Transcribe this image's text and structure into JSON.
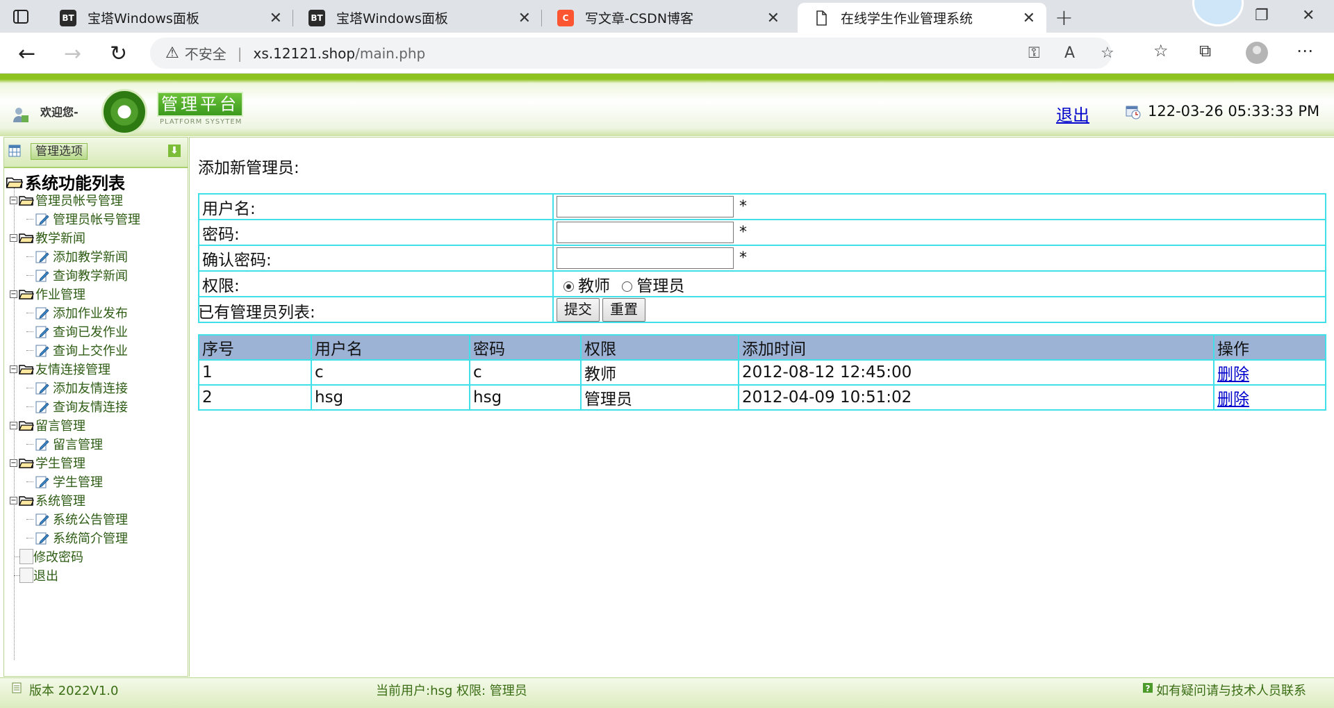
{
  "browser": {
    "tabs": [
      {
        "favicon_text": "BT",
        "favicon_color": "#2b2b2b",
        "title": "宝塔Windows面板"
      },
      {
        "favicon_text": "BT",
        "favicon_color": "#2b2b2b",
        "title": "宝塔Windows面板"
      },
      {
        "favicon_text": "C",
        "favicon_color": "#fc5531",
        "title": "写文章-CSDN博客"
      },
      {
        "favicon_text": "",
        "favicon_color": "#ffffff",
        "title": "在线学生作业管理系统"
      }
    ],
    "active_tab": 3,
    "address": {
      "security_label": "不安全",
      "host": "xs.12121.shop",
      "path": "/main.php"
    }
  },
  "header": {
    "greeting": "欢迎您-",
    "title": "管理平台",
    "subtitle": "PLATFORM SYSYTEM",
    "logout": "退出",
    "datetime": "122-03-26 05:33:33 PM"
  },
  "sidebar": {
    "header_label": "管理选项",
    "root_label": "系统功能列表",
    "groups": [
      {
        "label": "管理员帐号管理",
        "items": [
          "管理员帐号管理"
        ]
      },
      {
        "label": "教学新闻",
        "items": [
          "添加教学新闻",
          "查询教学新闻"
        ]
      },
      {
        "label": "作业管理",
        "items": [
          "添加作业发布",
          "查询已发作业",
          "查询上交作业"
        ]
      },
      {
        "label": "友情连接管理",
        "items": [
          "添加友情连接",
          "查询友情连接"
        ]
      },
      {
        "label": "留言管理",
        "items": [
          "留言管理"
        ]
      },
      {
        "label": "学生管理",
        "items": [
          "学生管理"
        ]
      },
      {
        "label": "系统管理",
        "items": [
          "系统公告管理",
          "系统简介管理"
        ]
      }
    ],
    "extra_items": [
      "修改密码",
      "退出"
    ]
  },
  "form": {
    "title": "添加新管理员:",
    "username_label": "用户名:",
    "password_label": "密码:",
    "confirm_label": "确认密码:",
    "role_label": "权限:",
    "required_mark": "*",
    "role_options": [
      "教师",
      "管理员"
    ],
    "role_selected": "教师",
    "submit_label": "提交",
    "reset_label": "重置",
    "username_value": "",
    "password_value": "",
    "confirm_value": ""
  },
  "admin_list": {
    "title": "已有管理员列表:",
    "columns": [
      "序号",
      "用户名",
      "密码",
      "权限",
      "添加时间",
      "操作"
    ],
    "rows": [
      {
        "id": "1",
        "username": "c",
        "password": "c",
        "role": "教师",
        "added": "2012-08-12 12:45:00",
        "action": "删除"
      },
      {
        "id": "2",
        "username": "hsg",
        "password": "hsg",
        "role": "管理员",
        "added": "2012-04-09 10:51:02",
        "action": "删除"
      }
    ]
  },
  "footer": {
    "version": "版本 2022V1.0",
    "current_user": "当前用户:hsg 权限: 管理员",
    "help": "如有疑问请与技术人员联系"
  },
  "colors": {
    "accent_green": "#8ec21f",
    "table_border": "#3fe0e8",
    "table_header": "#9db3d6",
    "link": "#0000cc"
  }
}
